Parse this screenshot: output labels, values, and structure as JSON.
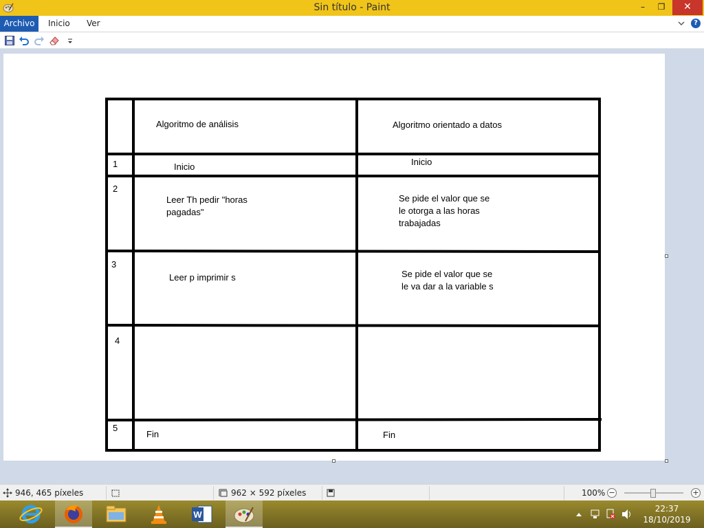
{
  "window": {
    "title": "Sin título - Paint",
    "buttons": {
      "minimize": "–",
      "maximize": "❐",
      "close": "✕"
    }
  },
  "ribbon": {
    "tabs": [
      {
        "label": "Archivo"
      },
      {
        "label": "Inicio"
      },
      {
        "label": "Ver"
      }
    ],
    "help": "?"
  },
  "quick_access": {
    "items": [
      "save-icon",
      "undo-icon",
      "redo-icon",
      "eraser-icon",
      "customize-dropdown-icon"
    ]
  },
  "table": {
    "headers": {
      "col1": "Algoritmo de análisis",
      "col2": "Algoritmo orientado a datos"
    },
    "rows": [
      {
        "num": "1",
        "col1": "Inicio",
        "col2": "Inicio"
      },
      {
        "num": "2",
        "col1": "Leer Th pedir \"horas\npagadas\"",
        "col2": "Se pide el valor que se\nle otorga a las horas\ntrabajadas"
      },
      {
        "num": "3",
        "col1": "Leer p imprimir s",
        "col2": "Se pide el valor que se\nle va dar a la variable s"
      },
      {
        "num": "4",
        "col1": "",
        "col2": ""
      },
      {
        "num": "5",
        "col1": "Fin",
        "col2": "Fin"
      }
    ]
  },
  "status": {
    "cursor_position": "946, 465 píxeles",
    "canvas_size": "962 × 592 píxeles",
    "zoom": "100%",
    "zoom_minus": "−",
    "zoom_plus": "+"
  },
  "taskbar": {
    "apps": [
      "internet-explorer-icon",
      "firefox-icon",
      "file-explorer-icon",
      "vlc-icon",
      "word-icon",
      "paint-icon"
    ],
    "time": "22:37",
    "date": "18/10/2019"
  },
  "colors": {
    "titlebar": "#f0c419",
    "file_tab": "#1e5cb3",
    "close_button": "#c7352b",
    "workspace": "#cfd9e7"
  }
}
